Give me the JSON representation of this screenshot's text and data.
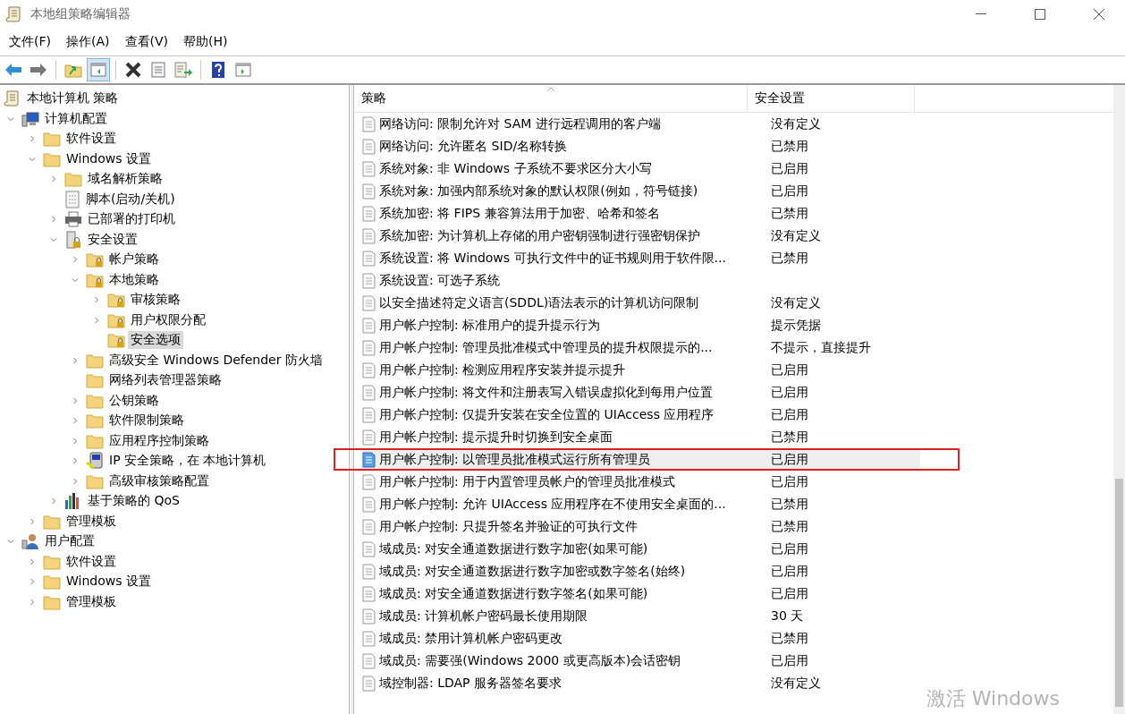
{
  "window": {
    "title": "本地组策略编辑器"
  },
  "menu": [
    "文件(F)",
    "操作(A)",
    "查看(V)",
    "帮助(H)"
  ],
  "toolbar": [
    {
      "kind": "back",
      "selected": false
    },
    {
      "kind": "forward",
      "selected": false
    },
    {
      "kind": "sep"
    },
    {
      "kind": "up",
      "selected": false
    },
    {
      "kind": "tree",
      "selected": true
    },
    {
      "kind": "sep"
    },
    {
      "kind": "delete",
      "selected": false
    },
    {
      "kind": "properties",
      "selected": false
    },
    {
      "kind": "export",
      "selected": false
    },
    {
      "kind": "sep"
    },
    {
      "kind": "help",
      "selected": false
    },
    {
      "kind": "pane",
      "selected": false
    }
  ],
  "tree": [
    {
      "label": "本地计算机 策略",
      "kind": "scroll",
      "selected": false,
      "children": [
        {
          "label": "计算机配置",
          "kind": "computer",
          "expanded": true,
          "selected": false,
          "children": [
            {
              "label": "软件设置",
              "kind": "folder",
              "expanded": false,
              "selected": false
            },
            {
              "label": "Windows 设置",
              "kind": "folder",
              "expanded": true,
              "selected": false,
              "children": [
                {
                  "label": "域名解析策略",
                  "kind": "folder",
                  "expanded": false,
                  "selected": false
                },
                {
                  "label": "脚本(启动/关机)",
                  "kind": "script",
                  "selected": false
                },
                {
                  "label": "已部署的打印机",
                  "kind": "printer",
                  "expanded": false,
                  "selected": false
                },
                {
                  "label": "安全设置",
                  "kind": "secserver",
                  "expanded": true,
                  "selected": false,
                  "children": [
                    {
                      "label": "帐户策略",
                      "kind": "lockfolder",
                      "expanded": false,
                      "selected": false
                    },
                    {
                      "label": "本地策略",
                      "kind": "lockfolder",
                      "expanded": true,
                      "selected": false,
                      "children": [
                        {
                          "label": "审核策略",
                          "kind": "lockfolder",
                          "expanded": false,
                          "selected": false
                        },
                        {
                          "label": "用户权限分配",
                          "kind": "lockfolder",
                          "expanded": false,
                          "selected": false
                        },
                        {
                          "label": "安全选项",
                          "kind": "lockfolder",
                          "selected": true
                        }
                      ]
                    },
                    {
                      "label": "高级安全 Windows Defender 防火墙",
                      "kind": "folder",
                      "expanded": false,
                      "selected": false
                    },
                    {
                      "label": "网络列表管理器策略",
                      "kind": "folder",
                      "selected": false
                    },
                    {
                      "label": "公钥策略",
                      "kind": "folder",
                      "expanded": false,
                      "selected": false
                    },
                    {
                      "label": "软件限制策略",
                      "kind": "folder",
                      "expanded": false,
                      "selected": false
                    },
                    {
                      "label": "应用程序控制策略",
                      "kind": "folder",
                      "expanded": false,
                      "selected": false
                    },
                    {
                      "label": "IP 安全策略，在 本地计算机",
                      "kind": "ipsec",
                      "expanded": false,
                      "selected": false
                    },
                    {
                      "label": "高级审核策略配置",
                      "kind": "folder",
                      "expanded": false,
                      "selected": false
                    }
                  ]
                },
                {
                  "label": "基于策略的 QoS",
                  "kind": "qos",
                  "expanded": false,
                  "selected": false
                }
              ]
            },
            {
              "label": "管理模板",
              "kind": "folder",
              "expanded": false,
              "selected": false
            }
          ]
        },
        {
          "label": "用户配置",
          "kind": "user",
          "expanded": true,
          "selected": false,
          "children": [
            {
              "label": "软件设置",
              "kind": "folder",
              "expanded": false,
              "selected": false
            },
            {
              "label": "Windows 设置",
              "kind": "folder",
              "expanded": false,
              "selected": false
            },
            {
              "label": "管理模板",
              "kind": "folder",
              "expanded": false,
              "selected": false
            }
          ]
        }
      ]
    }
  ],
  "table": {
    "columns": [
      "策略",
      "安全设置"
    ],
    "rows": [
      {
        "policy": "网络访问: 限制允许对 SAM 进行远程调用的客户端",
        "setting": "没有定义",
        "selected": false,
        "boxed": false
      },
      {
        "policy": "网络访问: 允许匿名 SID/名称转换",
        "setting": "已禁用",
        "selected": false,
        "boxed": false
      },
      {
        "policy": "系统对象: 非 Windows 子系统不要求区分大小写",
        "setting": "已启用",
        "selected": false,
        "boxed": false
      },
      {
        "policy": "系统对象: 加强内部系统对象的默认权限(例如，符号链接)",
        "setting": "已启用",
        "selected": false,
        "boxed": false
      },
      {
        "policy": "系统加密: 将 FIPS 兼容算法用于加密、哈希和签名",
        "setting": "已禁用",
        "selected": false,
        "boxed": false
      },
      {
        "policy": "系统加密: 为计算机上存储的用户密钥强制进行强密钥保护",
        "setting": "没有定义",
        "selected": false,
        "boxed": false
      },
      {
        "policy": "系统设置: 将 Windows 可执行文件中的证书规则用于软件限...",
        "setting": "已禁用",
        "selected": false,
        "boxed": false
      },
      {
        "policy": "系统设置: 可选子系统",
        "selected": false,
        "boxed": false
      },
      {
        "policy": "以安全描述符定义语言(SDDL)语法表示的计算机访问限制",
        "setting": "没有定义",
        "selected": false,
        "boxed": false
      },
      {
        "policy": "用户帐户控制: 标准用户的提升提示行为",
        "setting": "提示凭据",
        "selected": false,
        "boxed": false
      },
      {
        "policy": "用户帐户控制: 管理员批准模式中管理员的提升权限提示的...",
        "setting": "不提示，直接提升",
        "selected": false,
        "boxed": false
      },
      {
        "policy": "用户帐户控制: 检测应用程序安装并提示提升",
        "setting": "已启用",
        "selected": false,
        "boxed": false
      },
      {
        "policy": "用户帐户控制: 将文件和注册表写入错误虚拟化到每用户位置",
        "setting": "已启用",
        "selected": false,
        "boxed": false
      },
      {
        "policy": "用户帐户控制: 仅提升安装在安全位置的 UIAccess 应用程序",
        "setting": "已启用",
        "selected": false,
        "boxed": false
      },
      {
        "policy": "用户帐户控制: 提示提升时切换到安全桌面",
        "setting": "已禁用",
        "selected": false,
        "boxed": false
      },
      {
        "policy": "用户帐户控制: 以管理员批准模式运行所有管理员",
        "setting": "已启用",
        "selected": true,
        "boxed": true
      },
      {
        "policy": "用户帐户控制: 用于内置管理员帐户的管理员批准模式",
        "setting": "已启用",
        "selected": false,
        "boxed": false
      },
      {
        "policy": "用户帐户控制: 允许 UIAccess 应用程序在不使用安全桌面的...",
        "setting": "已禁用",
        "selected": false,
        "boxed": false
      },
      {
        "policy": "用户帐户控制: 只提升签名并验证的可执行文件",
        "setting": "已禁用",
        "selected": false,
        "boxed": false
      },
      {
        "policy": "域成员: 对安全通道数据进行数字加密(如果可能)",
        "setting": "已启用",
        "selected": false,
        "boxed": false
      },
      {
        "policy": "域成员: 对安全通道数据进行数字加密或数字签名(始终)",
        "setting": "已启用",
        "selected": false,
        "boxed": false
      },
      {
        "policy": "域成员: 对安全通道数据进行数字签名(如果可能)",
        "setting": "已启用",
        "selected": false,
        "boxed": false
      },
      {
        "policy": "域成员: 计算机帐户密码最长使用期限",
        "setting": "30 天",
        "selected": false,
        "boxed": false
      },
      {
        "policy": "域成员: 禁用计算机帐户密码更改",
        "setting": "已禁用",
        "selected": false,
        "boxed": false
      },
      {
        "policy": "域成员: 需要强(Windows 2000 或更高版本)会话密钥",
        "setting": "已启用",
        "selected": false,
        "boxed": false
      },
      {
        "policy": "域控制器: LDAP 服务器签名要求",
        "setting": "没有定义",
        "selected": false,
        "boxed": false
      }
    ]
  },
  "activation_notice": "激活 Windows"
}
